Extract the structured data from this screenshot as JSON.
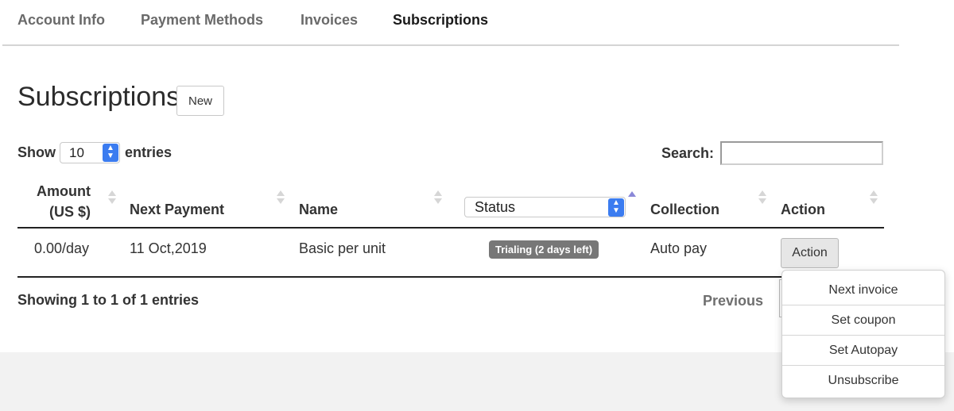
{
  "tabs": [
    {
      "label": "Account Info",
      "active": false
    },
    {
      "label": "Payment Methods",
      "active": false
    },
    {
      "label": "Invoices",
      "active": false
    },
    {
      "label": "Subscriptions",
      "active": true
    }
  ],
  "page": {
    "title": "Subscriptions",
    "new_button": "New"
  },
  "length_control": {
    "show_label": "Show",
    "value": "10",
    "entries_label": "entries"
  },
  "search": {
    "label": "Search:",
    "value": ""
  },
  "table": {
    "headers": {
      "amount_line1": "Amount",
      "amount_line2": "(US $)",
      "next_payment": "Next Payment",
      "name": "Name",
      "status_filter": "Status",
      "collection": "Collection",
      "action": "Action"
    },
    "rows": [
      {
        "amount": "0.00/day",
        "next_payment": "11 Oct,2019",
        "name": "Basic per unit",
        "status": "Trialing (2 days left)",
        "collection": "Auto pay",
        "action_label": "Action"
      }
    ]
  },
  "footer": {
    "info": "Showing 1 to 1 of 1 entries",
    "previous": "Previous"
  },
  "action_menu": {
    "items": [
      "Next invoice",
      "Set coupon",
      "Set Autopay",
      "Unsubscribe"
    ]
  },
  "colors": {
    "status_badge": "#777777",
    "select_stepper": "#3b7cf0",
    "sort_active": "#8a88d8"
  }
}
